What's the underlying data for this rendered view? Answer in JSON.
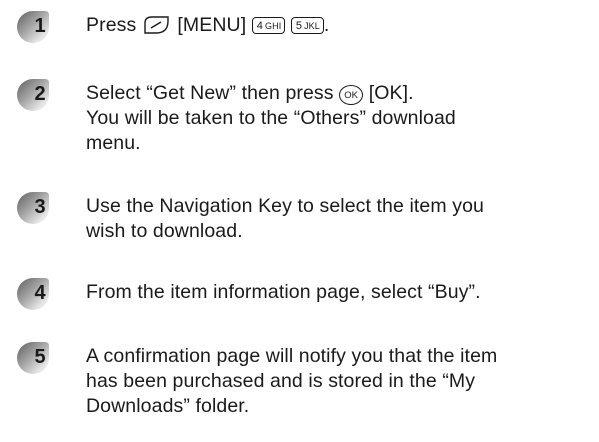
{
  "steps": [
    {
      "number": "1",
      "line1_before": "Press ",
      "menu_label": "[MENU]",
      "key_a": {
        "digit": "4",
        "letters": "GHI"
      },
      "key_b": {
        "digit": "5",
        "letters": "JKL"
      },
      "line1_after": "."
    },
    {
      "number": "2",
      "line1_before": "Select “Get New” then press ",
      "ok_glyph": "OK",
      "ok_label": "[OK].",
      "line2": "You will be taken to the “Others” download",
      "line3": "menu."
    },
    {
      "number": "3",
      "line1": "Use the Navigation Key to select the item you",
      "line2": "wish to download."
    },
    {
      "number": "4",
      "line1": "From the item information page, select “Buy”."
    },
    {
      "number": "5",
      "line1": "A confirmation page will notify you that the item",
      "line2": "has been purchased and is stored in the “My",
      "line3": "Downloads” folder."
    }
  ],
  "icons": {
    "bullet": "step-number-bullet-icon",
    "menu_key": "menu-softkey-icon",
    "ok_key": "ok-button-icon",
    "numeric_key": "keypad-key-icon"
  },
  "colors": {
    "bullet_dark": "#6f6f6f",
    "bullet_light": "#f2f2f2",
    "text": "#1a1a1a"
  }
}
